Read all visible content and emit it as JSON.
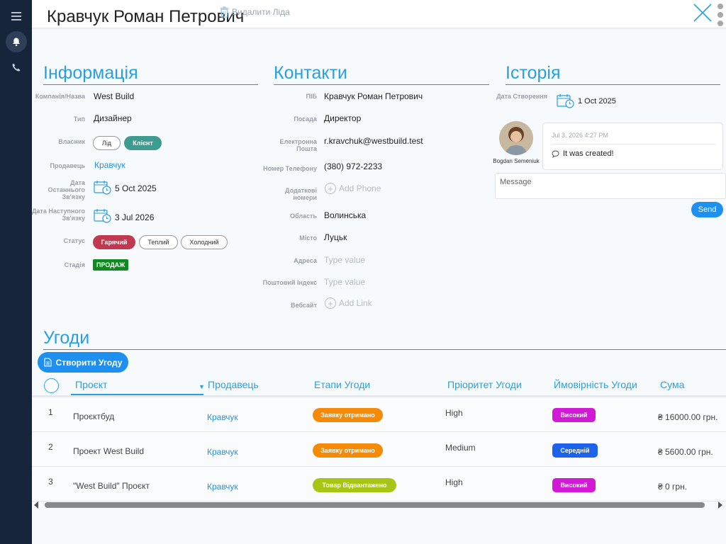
{
  "header": {
    "lead_name": "Кравчук Роман Петрович",
    "delete_label": "Видалити Ліда"
  },
  "info": {
    "title": "Інформація",
    "company_label": "Компанія/Назва",
    "company_value": "West Build",
    "type_label": "Тип",
    "type_value": "Дизайнер",
    "owner_label": "Власник",
    "owner_options": [
      "Лід",
      "Клієнт"
    ],
    "owner_selected": "Клієнт",
    "seller_label": "Продавець",
    "seller_value": "Кравчук",
    "last_call_label": "Дата Останнього Зв'язку",
    "last_call_value": "5 Oct 2025",
    "next_call_label": "Дата Наступного Зв'язку",
    "next_call_value": "3 Jul 2026",
    "status_label": "Статус",
    "status_options": [
      "Гарячий",
      "Теплий",
      "Холодний"
    ],
    "status_selected": "Гарячий",
    "stage_label": "Стадія",
    "stage_value": "ПРОДАЖ"
  },
  "contacts": {
    "title": "Контакти",
    "fullname_label": "ПІБ",
    "fullname_value": "Кравчук Роман Петрович",
    "position_label": "Посада",
    "position_value": "Директор",
    "email_label": "Електронна Пошта",
    "email_value": "r.kravchuk@westbuild.test",
    "phone_label": "Номер Телефону",
    "phone_value": "(380) 972-2233",
    "extra_phones_label": "Додаткові номери",
    "add_phone_label": "Add Phone",
    "region_label": "Область",
    "region_value": "Волинська",
    "city_label": "Місто",
    "city_value": "Луцьк",
    "address_label": "Адреса",
    "address_placeholder": "Type value",
    "zip_label": "Поштовий Індекс",
    "zip_placeholder": "Type value",
    "website_label": "Вебсайт",
    "add_link_label": "Add Link"
  },
  "history": {
    "title": "Історія",
    "created_label": "Дата Створення",
    "created_value": "1 Oct 2025",
    "author_name": "Bogdan Semeniuk",
    "entry_time": "Jul 3, 2026 4:27 PM",
    "entry_text": "It was created!",
    "message_placeholder": "Message",
    "send_label": "Send"
  },
  "deals": {
    "title": "Угоди",
    "create_label": "Створити Угоду",
    "columns": [
      "Проєкт",
      "Продавець",
      "Етапи Угоди",
      "Пріоритет Угоди",
      "Ймовірність Угоди",
      "Сума"
    ],
    "rows": [
      {
        "num": "1",
        "project": "Проєктбуд",
        "seller": "Кравчук",
        "stage": "Заявку отримано",
        "stage_color": "#f58a07",
        "priority": "High",
        "probability": "Високий",
        "prob_color": "#d21ad6",
        "sum": "₴ 16000.00 грн."
      },
      {
        "num": "2",
        "project": "Проект West Build",
        "seller": "Кравчук",
        "stage": "Заявку отримано",
        "stage_color": "#f58a07",
        "priority": "Medium",
        "probability": "Середній",
        "prob_color": "#1c62ea",
        "sum": "₴ 5600.00 грн."
      },
      {
        "num": "3",
        "project": "\"West Build\" Проєкт",
        "seller": "Кравчук",
        "stage": "Товар Відвантажено",
        "stage_color": "#a6c515",
        "priority": "High",
        "probability": "Високий",
        "prob_color": "#d21ad6",
        "sum": "₴ 0 грн."
      }
    ]
  },
  "colors": {
    "accent": "#2a9fe0",
    "rail": "#17253a",
    "client_pill": "#3d9c8f",
    "hot_pill": "#c1394f",
    "stage_badge": "#0f8a1e"
  }
}
